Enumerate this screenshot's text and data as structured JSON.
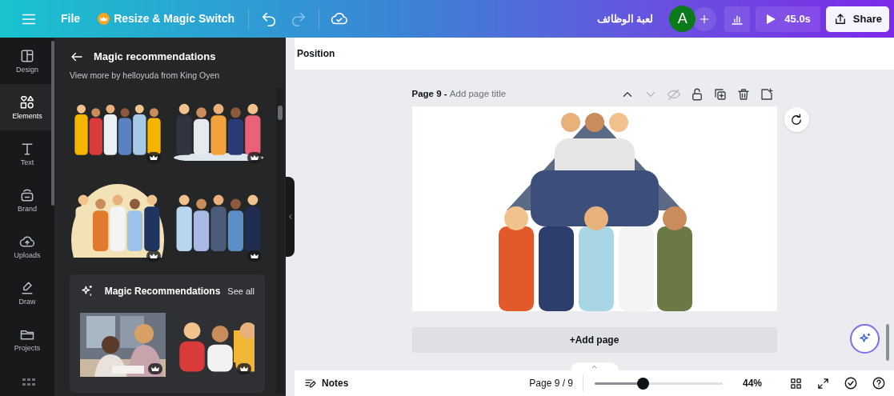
{
  "top_bar": {
    "file": "File",
    "resize": "Resize & Magic Switch",
    "design_title": "لعبة الوظائف",
    "avatar": "A",
    "play": "45.0s",
    "share": "Share"
  },
  "rail": [
    {
      "label": "Design",
      "selected": false
    },
    {
      "label": "Elements",
      "selected": true
    },
    {
      "label": "Text",
      "selected": false
    },
    {
      "label": "Brand",
      "selected": false
    },
    {
      "label": "Uploads",
      "selected": false
    },
    {
      "label": "Draw",
      "selected": false
    },
    {
      "label": "Projects",
      "selected": false
    }
  ],
  "panel": {
    "title": "Magic recommendations",
    "attribution": "View more by helloyuda from King Oyen",
    "graphics": [
      {
        "kind": "picture",
        "premium": true
      },
      {
        "kind": "picture",
        "premium": true
      },
      {
        "kind": "picture",
        "premium": true
      },
      {
        "kind": "picture",
        "premium": true
      }
    ],
    "recommendations": {
      "title": "Magic Recommendations",
      "see_all": "See all",
      "items": [
        {
          "kind": "picture",
          "premium": true
        },
        {
          "kind": "picture",
          "premium": true
        }
      ]
    }
  },
  "toolbar": {
    "label": "Position"
  },
  "page": {
    "label": "Page 9 -",
    "title_placeholder": "Add page title",
    "add_page": "+Add page"
  },
  "bottom_bar": {
    "notes": "Notes",
    "page_count": "Page 9 / 9",
    "zoom": {
      "level": 0.375
    },
    "zoom_reading": "44%"
  }
}
